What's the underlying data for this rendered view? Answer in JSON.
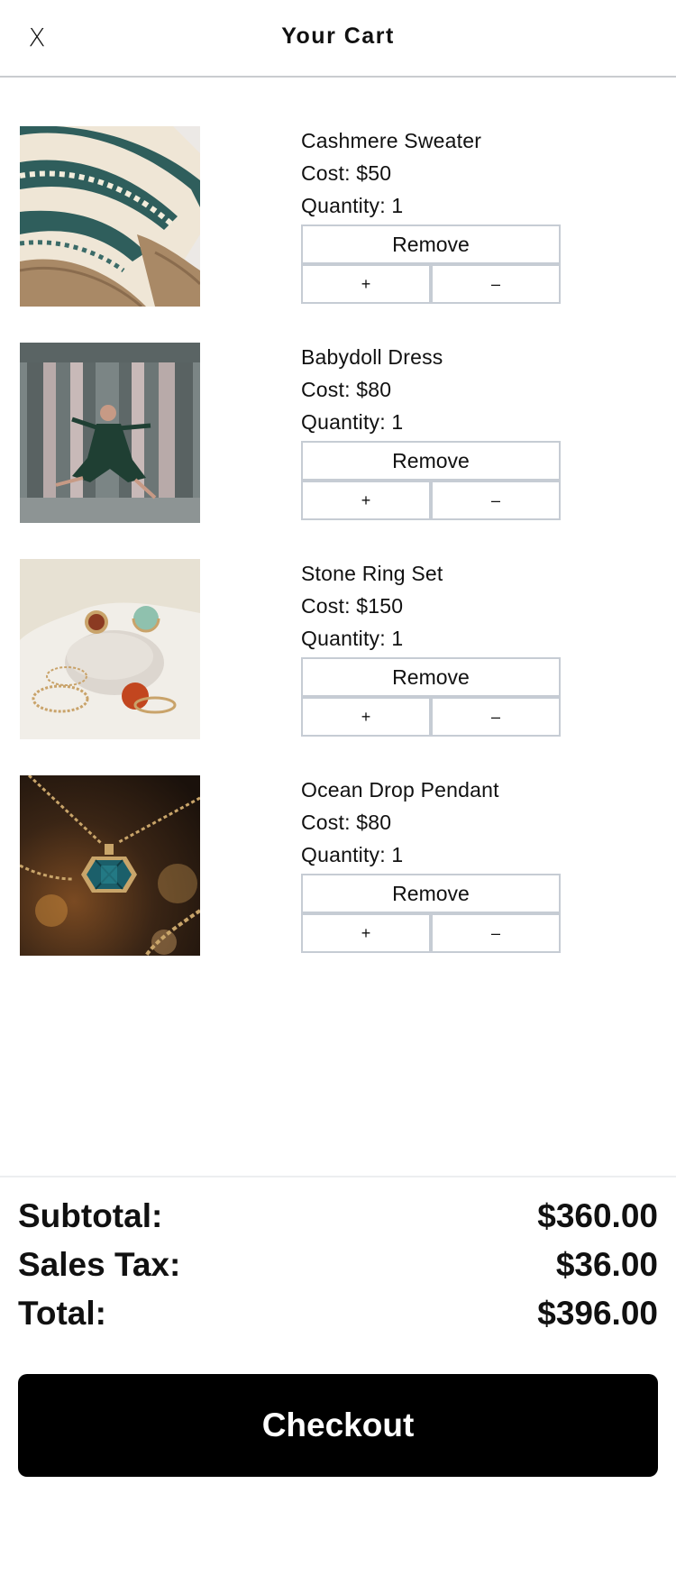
{
  "header": {
    "title": "Your Cart",
    "close_label": "X"
  },
  "cart": {
    "items": [
      {
        "name": "Cashmere Sweater",
        "cost": "Cost: $50",
        "quantity": "Quantity: 1",
        "remove_label": "Remove",
        "plus_label": "+",
        "minus_label": "–",
        "image": "sweater-photo"
      },
      {
        "name": "Babydoll Dress",
        "cost": "Cost: $80",
        "quantity": "Quantity: 1",
        "remove_label": "Remove",
        "plus_label": "+",
        "minus_label": "–",
        "image": "dress-photo"
      },
      {
        "name": "Stone Ring Set",
        "cost": "Cost: $150",
        "quantity": "Quantity: 1",
        "remove_label": "Remove",
        "plus_label": "+",
        "minus_label": "–",
        "image": "rings-photo"
      },
      {
        "name": "Ocean Drop Pendant",
        "cost": "Cost: $80",
        "quantity": "Quantity: 1",
        "remove_label": "Remove",
        "plus_label": "+",
        "minus_label": "–",
        "image": "pendant-photo"
      }
    ]
  },
  "summary": {
    "subtotal_label": "Subtotal:",
    "subtotal_value": "$360.00",
    "tax_label": "Sales Tax:",
    "tax_value": "$36.00",
    "total_label": "Total:",
    "total_value": "$396.00"
  },
  "checkout": {
    "label": "Checkout"
  },
  "colors": {
    "button_border": "#c6ccd4",
    "checkout_bg": "#000000",
    "checkout_text": "#ffffff"
  }
}
